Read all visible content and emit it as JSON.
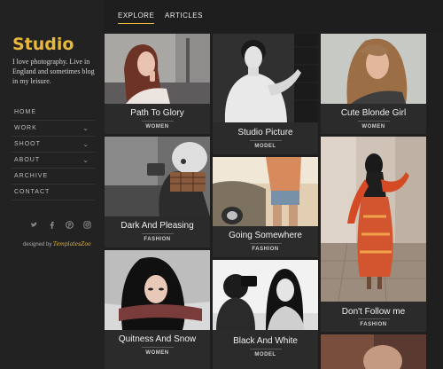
{
  "site": {
    "logo": "Studio",
    "tagline": "I love photography. Live in England and sometimes blog in my leisure."
  },
  "nav": {
    "items": [
      {
        "label": "HOME",
        "has_submenu": false
      },
      {
        "label": "WORK",
        "has_submenu": true
      },
      {
        "label": "SHOOT",
        "has_submenu": true
      },
      {
        "label": "ABOUT",
        "has_submenu": true
      },
      {
        "label": "ARCHIVE",
        "has_submenu": false
      },
      {
        "label": "CONTACT",
        "has_submenu": false
      }
    ]
  },
  "social": [
    "twitter-icon",
    "facebook-icon",
    "pinterest-icon",
    "instagram-icon"
  ],
  "credit": {
    "prefix": "designed by",
    "brand": "TemplatesZoo"
  },
  "topnav": {
    "explore": "EXPLORE",
    "articles": "ARTICLES"
  },
  "cards": [
    {
      "title": "Path To Glory",
      "category": "WOMEN"
    },
    {
      "title": "Studio Picture",
      "category": "MODEL"
    },
    {
      "title": "Cute Blonde Girl",
      "category": "WOMEN"
    },
    {
      "title": "Dark And Pleasing",
      "category": "FASHION"
    },
    {
      "title": "Going Somewhere",
      "category": "FASHION"
    },
    {
      "title": "Don't Follow me",
      "category": "FASHION"
    },
    {
      "title": "Quitness And Snow",
      "category": "WOMEN"
    },
    {
      "title": "Black And White",
      "category": "MODEL"
    }
  ],
  "colors": {
    "accent": "#e7b83c",
    "background": "#1f1f1f",
    "card": "#2b2b2b"
  }
}
